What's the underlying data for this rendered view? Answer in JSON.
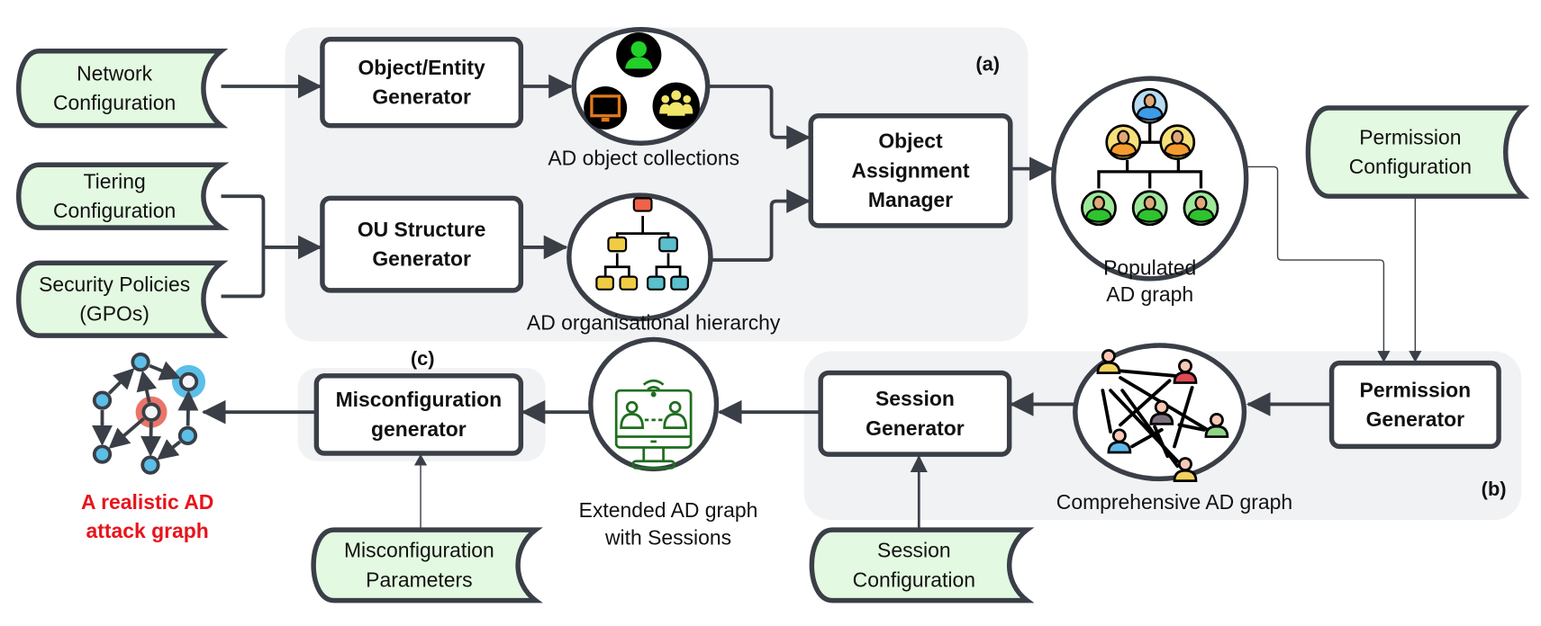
{
  "inputs": {
    "network": [
      "Network",
      "Configuration"
    ],
    "tiering": [
      "Tiering",
      "Configuration"
    ],
    "security": [
      "Security Policies",
      "(GPOs)"
    ],
    "permission": [
      "Permission",
      "Configuration"
    ],
    "misconfig": [
      "Misconfiguration",
      "Parameters"
    ],
    "session": [
      "Session",
      "Configuration"
    ]
  },
  "processes": {
    "object_entity": [
      "Object/Entity",
      "Generator"
    ],
    "ou_structure": [
      "OU Structure",
      "Generator"
    ],
    "assignment": [
      "Object",
      "Assignment",
      "Manager"
    ],
    "permission": [
      "Permission",
      "Generator"
    ],
    "session": [
      "Session",
      "Generator"
    ],
    "misconfig": [
      "Misconfiguration",
      "generator"
    ]
  },
  "artifacts": {
    "collections": "AD object collections",
    "hierarchy": "AD organisational hierarchy",
    "populated": [
      "Populated",
      "AD graph"
    ],
    "comprehensive": "Comprehensive AD graph",
    "extended": [
      "Extended AD graph",
      "with Sessions"
    ],
    "output": [
      "A realistic AD",
      "attack graph"
    ]
  },
  "groups": {
    "a": "(a)",
    "b": "(b)",
    "c": "(c)"
  },
  "colors": {
    "input_fill": "#e3f9e1",
    "stroke": "#3a3f47",
    "group_bg": "#f1f2f4",
    "output_text": "#e8141b",
    "session_icon": "#1f6e1f"
  }
}
